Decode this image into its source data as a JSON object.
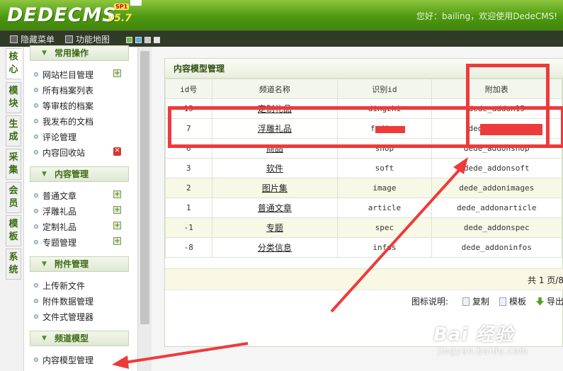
{
  "header": {
    "logo": "DEDECMS",
    "version": "v5.7",
    "badge": "SP1",
    "welcome": "您好：bailing，欢迎使用DedeCMS!"
  },
  "toolbar": {
    "hide_menu": "隐藏菜单",
    "site_map": "功能地图",
    "swatches": [
      "#7ab648",
      "#56aee0",
      "#c8c8c8",
      "#e6e6e6"
    ]
  },
  "side_tabs": [
    "核心",
    "模块",
    "生成",
    "采集",
    "会员",
    "模板",
    "系统"
  ],
  "menu": {
    "groups": [
      {
        "title": "常用操作",
        "items": [
          "网站栏目管理",
          "所有档案列表",
          "等审核的档案",
          "我发布的文档",
          "评论管理",
          "内容回收站"
        ]
      },
      {
        "title": "内容管理",
        "items": [
          "普通文章",
          "浮雕礼品",
          "定制礼品",
          "专题管理"
        ]
      },
      {
        "title": "附件管理",
        "items": [
          "上传新文件",
          "附件数据管理",
          "文件式管理器"
        ]
      },
      {
        "title": "频道模型",
        "items": [
          "内容模型管理"
        ]
      }
    ]
  },
  "panel": {
    "title": "内容模型管理",
    "columns": [
      "id号",
      "频道名称",
      "识别id",
      "附加表"
    ],
    "rows": [
      {
        "id": "15",
        "name": "定制礼品",
        "nid": "dingzhi",
        "table": "dede_addon15"
      },
      {
        "id": "7",
        "name": "浮雕礼品",
        "nid": "fudiao",
        "table": "dede_addon07"
      },
      {
        "id": "6",
        "name": "商品",
        "nid": "shop",
        "table": "dede_addonshop"
      },
      {
        "id": "3",
        "name": "软件",
        "nid": "soft",
        "table": "dede_addonsoft"
      },
      {
        "id": "2",
        "name": "图片集",
        "nid": "image",
        "table": "dede_addonimages"
      },
      {
        "id": "1",
        "name": "普通文章",
        "nid": "article",
        "table": "dede_addonarticle"
      },
      {
        "id": "-1",
        "name": "专题",
        "nid": "spec",
        "table": "dede_addonspec"
      },
      {
        "id": "-8",
        "name": "分类信息",
        "nid": "infos",
        "table": "dede_addoninfos"
      }
    ],
    "pager": "共 1 页/8",
    "legend": {
      "label": "图标说明:",
      "copy": "复制",
      "template": "模板",
      "export": "导出"
    }
  },
  "watermark": {
    "main": "Bai 经验",
    "sub": "jingyan.baidu.com"
  },
  "annotation_color": "#ef3a3a"
}
